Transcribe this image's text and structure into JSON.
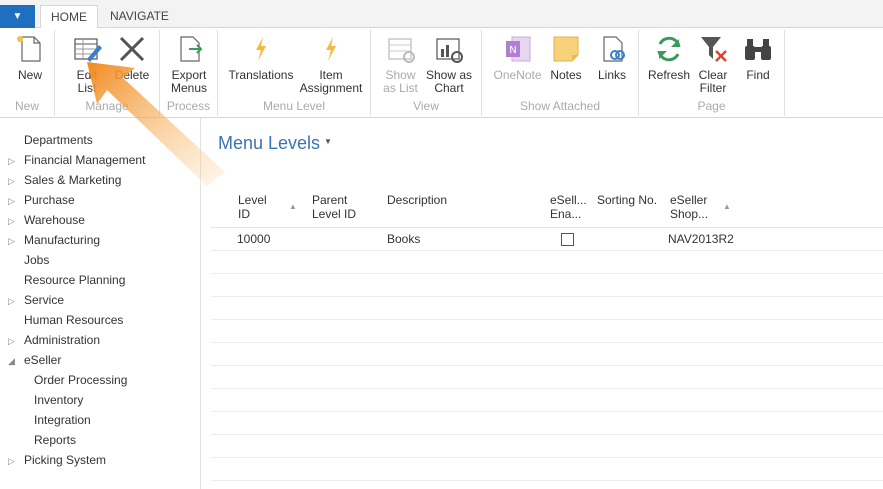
{
  "tabs": {
    "app_menu_icon": "chevron-down-icon",
    "home": "HOME",
    "navigate": "NAVIGATE"
  },
  "ribbon": {
    "groups": [
      {
        "label": "New",
        "buttons": [
          {
            "label": "New",
            "icon": "new-document-icon"
          }
        ]
      },
      {
        "label": "Manage",
        "buttons": [
          {
            "label": "Edit\nList",
            "icon": "edit-list-icon"
          },
          {
            "label": "Delete",
            "icon": "delete-x-icon"
          }
        ]
      },
      {
        "label": "Process",
        "buttons": [
          {
            "label": "Export\nMenus",
            "icon": "export-icon"
          }
        ]
      },
      {
        "label": "Menu Level",
        "buttons": [
          {
            "label": "Translations",
            "icon": "lightning-icon"
          },
          {
            "label": "Item\nAssignment",
            "icon": "lightning-icon"
          }
        ]
      },
      {
        "label": "View",
        "buttons": [
          {
            "label": "Show\nas List",
            "icon": "show-list-icon",
            "disabled": true
          },
          {
            "label": "Show as\nChart",
            "icon": "show-chart-icon"
          }
        ]
      },
      {
        "label": "Show Attached",
        "buttons": [
          {
            "label": "OneNote",
            "icon": "onenote-icon",
            "disabled": true
          },
          {
            "label": "Notes",
            "icon": "notes-icon"
          },
          {
            "label": "Links",
            "icon": "links-icon"
          }
        ]
      },
      {
        "label": "Page",
        "buttons": [
          {
            "label": "Refresh",
            "icon": "refresh-icon"
          },
          {
            "label": "Clear\nFilter",
            "icon": "clear-filter-icon"
          },
          {
            "label": "Find",
            "icon": "binoculars-icon"
          }
        ]
      }
    ]
  },
  "leftnav": {
    "items": [
      {
        "label": "Departments",
        "caret": ""
      },
      {
        "label": "Financial Management",
        "caret": "▷"
      },
      {
        "label": "Sales & Marketing",
        "caret": "▷"
      },
      {
        "label": "Purchase",
        "caret": "▷"
      },
      {
        "label": "Warehouse",
        "caret": "▷"
      },
      {
        "label": "Manufacturing",
        "caret": "▷"
      },
      {
        "label": "Jobs",
        "caret": ""
      },
      {
        "label": "Resource Planning",
        "caret": ""
      },
      {
        "label": "Service",
        "caret": "▷"
      },
      {
        "label": "Human Resources",
        "caret": ""
      },
      {
        "label": "Administration",
        "caret": "▷"
      },
      {
        "label": "eSeller",
        "caret": "◢"
      },
      {
        "label": "Order Processing",
        "caret": "",
        "sub": true
      },
      {
        "label": "Inventory",
        "caret": "",
        "sub": true
      },
      {
        "label": "Integration",
        "caret": "",
        "sub": true
      },
      {
        "label": "Reports",
        "caret": "",
        "sub": true
      },
      {
        "label": "Picking System",
        "caret": "▷"
      }
    ]
  },
  "main": {
    "title": "Menu Levels",
    "title_caret": "▼",
    "columns": [
      "Level\nID",
      "Parent\nLevel ID",
      "Description",
      "eSell...\nEna...",
      "Sorting No.",
      "eSeller\nShop..."
    ],
    "sort_glyph": "▲",
    "rows": [
      {
        "level_id": "10000",
        "parent_level_id": "",
        "description": "Books",
        "enabled": false,
        "sorting_no": "",
        "shop": "NAV2013R2"
      }
    ]
  },
  "colors": {
    "accent": "#1e6fc0",
    "title": "#3b73b3",
    "arrow": "#f59a38"
  }
}
